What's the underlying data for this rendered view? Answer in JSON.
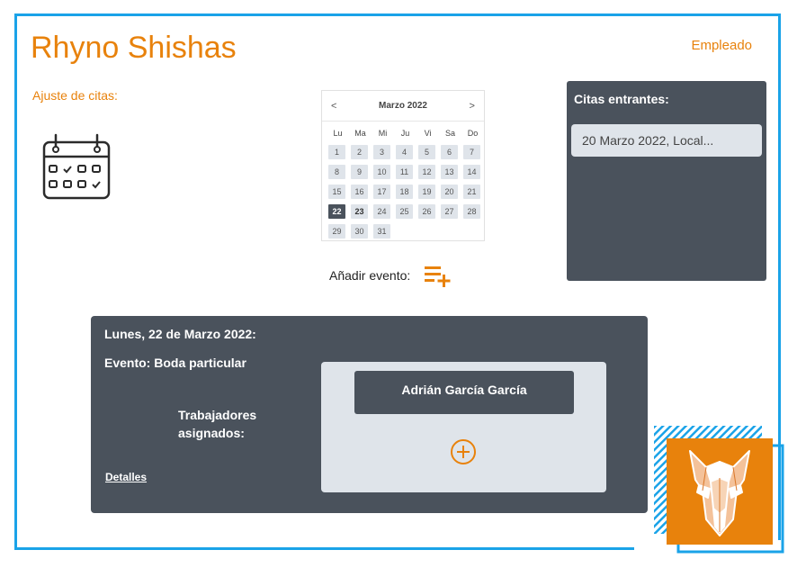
{
  "header": {
    "title": "Rhyno Shishas",
    "role_label": "Empleado",
    "subtitle": "Ajuste de citas:"
  },
  "icons": {
    "calendar": "calendar-check-icon",
    "add_event": "playlist-add-icon",
    "add_worker": "add-circle-icon",
    "logo": "rhino-logo"
  },
  "datepicker": {
    "month_label": "Marzo 2022",
    "prev_label": "<",
    "next_label": ">",
    "weekdays": [
      "Lu",
      "Ma",
      "Mi",
      "Ju",
      "Vi",
      "Sa",
      "Do"
    ],
    "days": [
      [
        "1",
        "2",
        "3",
        "4",
        "5",
        "6",
        "7"
      ],
      [
        "8",
        "9",
        "10",
        "11",
        "12",
        "13",
        "14"
      ],
      [
        "15",
        "16",
        "17",
        "18",
        "19",
        "20",
        "21"
      ],
      [
        "22",
        "23",
        "24",
        "25",
        "26",
        "27",
        "28"
      ],
      [
        "29",
        "30",
        "31"
      ]
    ],
    "selected_day": "22",
    "highlighted_day": "23"
  },
  "add_event": {
    "label": "Añadir evento:"
  },
  "incoming": {
    "title": "Citas entrantes:",
    "items": [
      "20 Marzo 2022, Local..."
    ]
  },
  "day_panel": {
    "date_title": "Lunes, 22 de Marzo 2022:",
    "event_label": "Evento: Boda particular",
    "workers_label": "Trabajadores asignados:",
    "details_link": "Detalles",
    "workers": [
      "Adrián García García"
    ]
  },
  "colors": {
    "accent": "#e8820c",
    "frame": "#1aa3e8",
    "panel": "#4a525c",
    "panel_light": "#dfe4ea"
  }
}
